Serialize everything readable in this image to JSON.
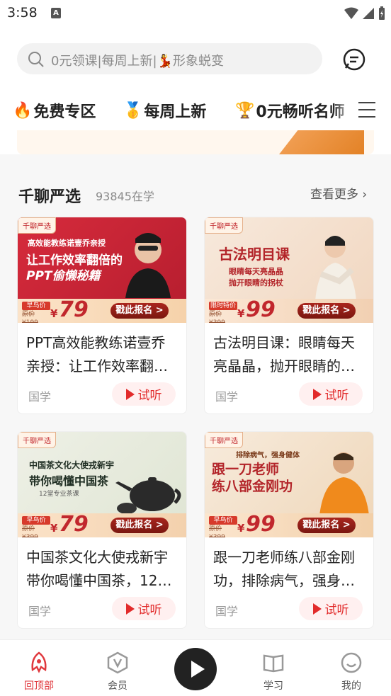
{
  "status": {
    "time": "3:58",
    "sim_label": "A"
  },
  "search": {
    "placeholder": "0元领课|每周上新|💃形象蜕变"
  },
  "tabs": [
    {
      "emoji": "🔥",
      "label": "免费专区"
    },
    {
      "emoji": "🥇",
      "label": "每周上新"
    },
    {
      "emoji": "🏆",
      "label": "0元畅听名师"
    }
  ],
  "section": {
    "title": "千聊严选",
    "count": "93845在学",
    "more": "查看更多"
  },
  "cards": [
    {
      "badge": "千聊严选",
      "pitch1": "高效能教练诺壹乔亲授",
      "pitch2": "让工作效率翻倍的",
      "pitch3": "PPT偷懒秘籍",
      "early": "早鸟价",
      "orig": "原价¥199",
      "yen": "¥",
      "price": "79",
      "cta": "戳此报名 >",
      "title": "PPT高效能教练诺壹乔亲授：让工作效率翻…",
      "category": "国学",
      "try_label": "试听"
    },
    {
      "badge": "千聊严选",
      "pitch1": "古法明目课",
      "pitch2": "眼睛每天亮晶晶",
      "pitch3": "抛开眼睛的拐杖",
      "early": "限时特价",
      "orig": "原价¥399",
      "yen": "¥",
      "price": "99",
      "cta": "戳此报名 >",
      "title": "古法明目课：眼睛每天亮晶晶，抛开眼睛的…",
      "category": "国学",
      "try_label": "试听"
    },
    {
      "badge": "千聊严选",
      "pitch1": "中国茶文化大使戎新宇",
      "pitch2": "带你喝懂中国茶",
      "pitch3": "12堂专业茶课",
      "early": "早鸟价",
      "orig": "原价¥399",
      "yen": "¥",
      "price": "79",
      "cta": "戳此报名 >",
      "title": "中国茶文化大使戎新宇带你喝懂中国茶，12…",
      "category": "国学",
      "try_label": "试听"
    },
    {
      "badge": "千聊严选",
      "pitch1": "排除病气，强身健体",
      "pitch2": "跟一刀老师",
      "pitch3": "练八部金刚功",
      "early": "早鸟价",
      "orig": "原价¥399",
      "yen": "¥",
      "price": "99",
      "cta": "戳此报名 >",
      "title": "跟一刀老师练八部金刚功，排除病气，强身…",
      "category": "国学",
      "try_label": "试听"
    }
  ],
  "nav": [
    {
      "label": "回顶部",
      "icon": "top-icon",
      "active": true
    },
    {
      "label": "会员",
      "icon": "member-v-icon",
      "active": false
    },
    {
      "label": "",
      "icon": "play-icon",
      "active": false
    },
    {
      "label": "学习",
      "icon": "book-icon",
      "active": false
    },
    {
      "label": "我的",
      "icon": "profile-icon",
      "active": false
    }
  ],
  "colors": {
    "accent": "#e0393e",
    "brand_red": "#c1272d",
    "bg": "#f7f7f7"
  }
}
